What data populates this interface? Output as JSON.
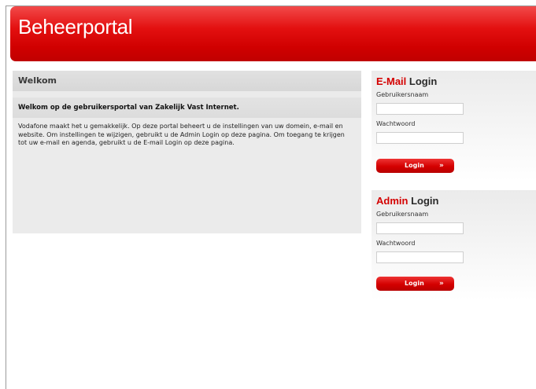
{
  "header": {
    "title": "Beheerportal"
  },
  "welcome": {
    "heading": "Welkom",
    "subheading": "Welkom op de gebruikersportal van Zakelijk Vast Internet.",
    "body": "Vodafone maakt het u gemakkelijk. Op deze portal beheert u de instellingen van uw domein, e-mail en website. Om instellingen te wijzigen, gebruikt u de Admin Login op deze pagina. Om toegang te krijgen tot uw e-mail en agenda, gebruikt u de E-mail Login op deze pagina."
  },
  "email_login": {
    "title_prefix": "E-Mail",
    "title_suffix": " Login",
    "username_label": "Gebruikersnaam",
    "username_value": "",
    "password_label": "Wachtwoord",
    "password_value": "",
    "button_label": "Login",
    "button_arrow": "»"
  },
  "admin_login": {
    "title_prefix": "Admin",
    "title_suffix": " Login",
    "username_label": "Gebruikersnaam",
    "username_value": "",
    "password_label": "Wachtwoord",
    "password_value": "",
    "button_label": "Login",
    "button_arrow": "»"
  },
  "colors": {
    "brand": "#d40000",
    "panel_bg": "#ebebeb"
  }
}
